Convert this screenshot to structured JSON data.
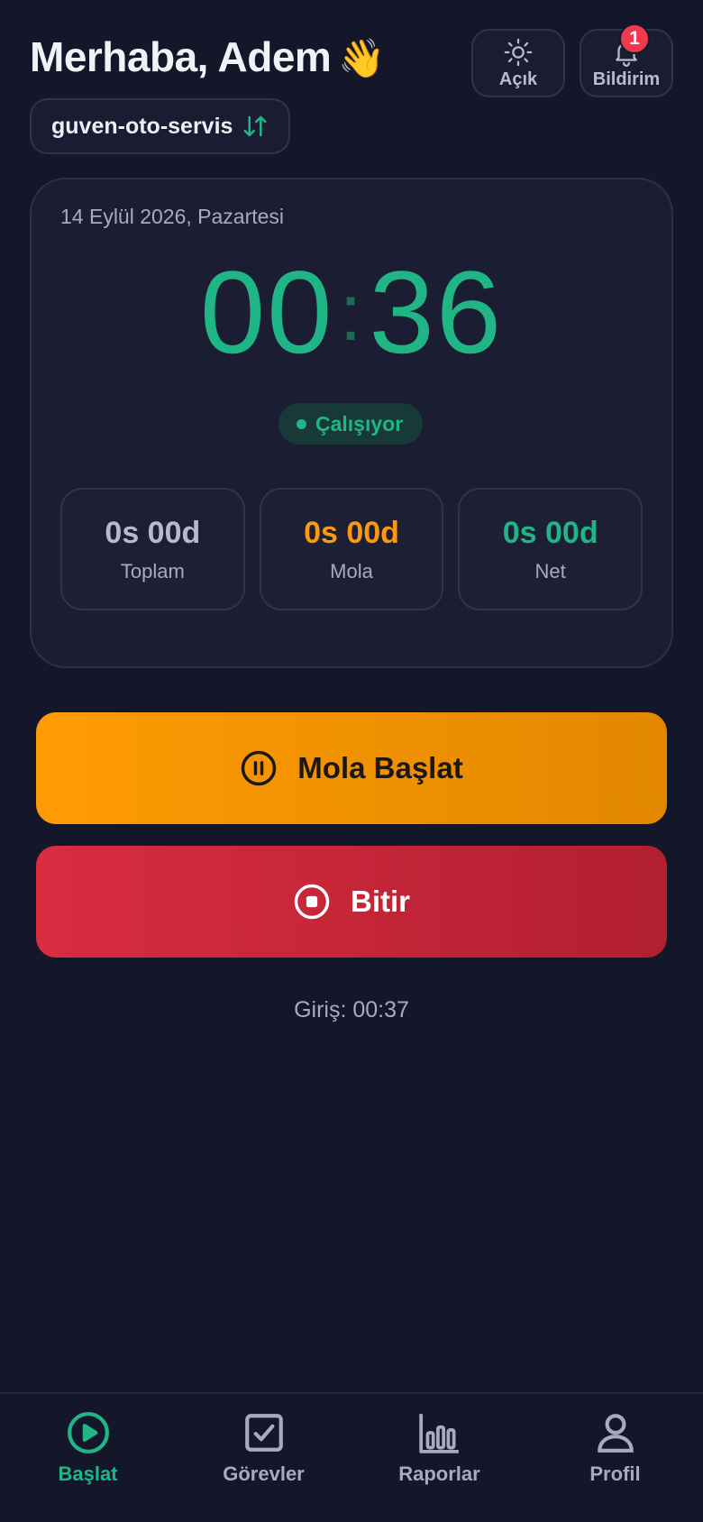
{
  "header": {
    "greeting": "Merhaba, Adem",
    "wave_emoji": "👋",
    "theme_label": "Açık",
    "notif_label": "Bildirim",
    "notif_count": "1"
  },
  "org": {
    "name": "guven-oto-servis"
  },
  "timer": {
    "date": "14 Eylül 2026, Pazartesi",
    "hours": "00",
    "minutes": "36",
    "status": "Çalışıyor"
  },
  "stats": [
    {
      "value": "0s 00d",
      "label": "Toplam"
    },
    {
      "value": "0s 00d",
      "label": "Mola"
    },
    {
      "value": "0s 00d",
      "label": "Net"
    }
  ],
  "actions": {
    "break_label": "Mola Başlat",
    "finish_label": "Bitir"
  },
  "login_time": "Giriş: 00:37",
  "tabs": [
    {
      "label": "Başlat",
      "icon": "play-circle-icon"
    },
    {
      "label": "Görevler",
      "icon": "checkbox-icon"
    },
    {
      "label": "Raporlar",
      "icon": "bar-chart-icon"
    },
    {
      "label": "Profil",
      "icon": "user-icon"
    }
  ],
  "colors": {
    "background": "#141729",
    "accent_green": "#20b587",
    "accent_orange": "#fb9a0e",
    "accent_red": "#d92c40",
    "badge_red": "#f0394f"
  }
}
